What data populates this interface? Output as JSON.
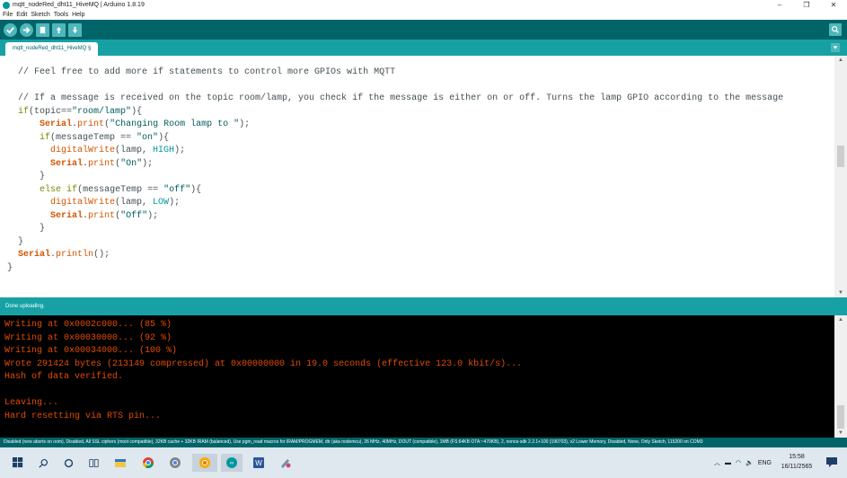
{
  "window": {
    "title": "mqtt_nodeRed_dht11_HiveMQ | Arduino 1.8.19",
    "controls": [
      "–",
      "❐",
      "✕"
    ]
  },
  "menu": [
    "File",
    "Edit",
    "Sketch",
    "Tools",
    "Help"
  ],
  "toolbar": {
    "buttons": [
      "verify-icon",
      "upload-icon",
      "new-icon",
      "open-icon",
      "save-icon"
    ],
    "serial_monitor": "magnifier-icon"
  },
  "tabs": [
    {
      "label": "mqtt_nodeRed_dht11_HiveMQ §"
    }
  ],
  "editor": {
    "lines": [
      "  // Feel free to add more if statements to control more GPIOs with MQTT",
      "",
      "  // If a message is received on the topic room/lamp, you check if the message is either on or off. Turns the lamp GPIO according to the message",
      "  if(topic==\"room/lamp\"){",
      "      Serial.print(\"Changing Room lamp to \");",
      "      if(messageTemp == \"on\"){",
      "        digitalWrite(lamp, HIGH);",
      "        Serial.print(\"On\");",
      "      }",
      "      else if(messageTemp == \"off\"){",
      "        digitalWrite(lamp, LOW);",
      "        Serial.print(\"Off\");",
      "      }",
      "  }",
      "  Serial.println();",
      "}"
    ]
  },
  "status": {
    "text": "Done uploading."
  },
  "console": {
    "lines": [
      "Writing at 0x0002c000... (85 %)",
      "Writing at 0x00030000... (92 %)",
      "Writing at 0x00034000... (100 %)",
      "Wrote 291424 bytes (213149 compressed) at 0x00000000 in 19.0 seconds (effective 123.0 kbit/s)...",
      "Hash of data verified.",
      "",
      "Leaving...",
      "Hard resetting via RTS pin..."
    ]
  },
  "board_info": "Disabled (new aborts on oom), Disabled, All SSL ciphers (most compatible), 32KB cache + 32KB IRAM (balanced), Use pgm_read macros for IRAM/PROGMEM, dtr (aka nodemcu), 26 MHz, 40MHz, DOUT (compatible), 1MB (FS:64KB OTA:~470KB), 2, nonos-sdk 2.2.1+100 (190703), v2 Lower Memory, Disabled, None, Only Sketch, 115200 on COM3",
  "taskbar": {
    "apps": [
      "windows-start-icon",
      "search-icon",
      "cortana-icon",
      "task-view-icon",
      "file-explorer-icon",
      "chrome-icon",
      "chrome-dev-icon",
      "chrome-canary-icon",
      "arduino-icon",
      "word-icon",
      "paint-icon"
    ],
    "tray": {
      "language": "ENG",
      "time": "15:58",
      "date": "16/11/2565"
    }
  },
  "colors": {
    "toolbar": "#006468",
    "tabbar": "#17a1a5",
    "console_text": "#e34c00",
    "keyword": "#d35400"
  }
}
